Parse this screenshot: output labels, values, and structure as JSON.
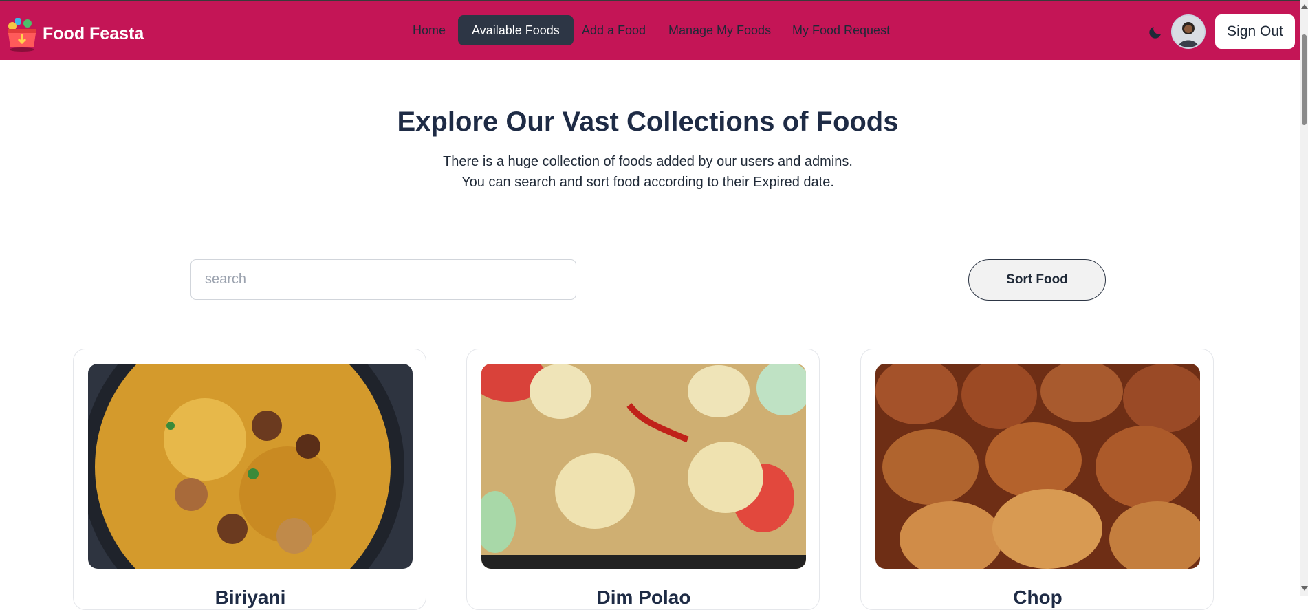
{
  "brand": {
    "name": "Food Feasta"
  },
  "nav": {
    "items": [
      {
        "label": "Home",
        "active": false
      },
      {
        "label": "Available Foods",
        "active": true
      },
      {
        "label": "Add a Food",
        "active": false
      },
      {
        "label": "Manage My Foods",
        "active": false
      },
      {
        "label": "My Food Request",
        "active": false
      }
    ]
  },
  "header": {
    "signout_label": "Sign Out"
  },
  "hero": {
    "title": "Explore Our Vast Collections of Foods",
    "desc_line1": "There is a huge collection of foods added by our users and admins.",
    "desc_line2": "You can search and sort food according to their Expired date."
  },
  "search": {
    "placeholder": "search",
    "value": ""
  },
  "sort": {
    "label": "Sort Food"
  },
  "foods": [
    {
      "name": "Biriyani"
    },
    {
      "name": "Dim Polao"
    },
    {
      "name": "Chop"
    }
  ],
  "colors": {
    "navbar": "#c41556",
    "active_nav": "#2d3645",
    "heading": "#1e2b45"
  }
}
